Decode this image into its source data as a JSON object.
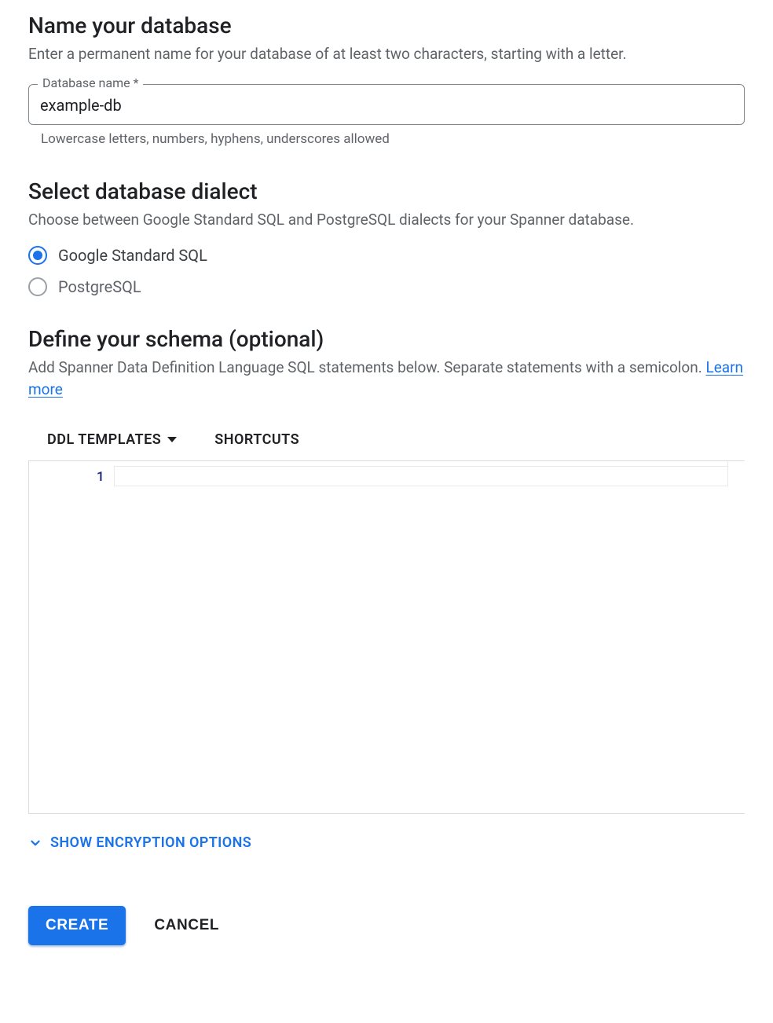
{
  "name_section": {
    "title": "Name your database",
    "description": "Enter a permanent name for your database of at least two characters, starting with a letter.",
    "field_label": "Database name *",
    "field_value": "example-db",
    "helper": "Lowercase letters, numbers, hyphens, underscores allowed"
  },
  "dialect_section": {
    "title": "Select database dialect",
    "description": "Choose between Google Standard SQL and PostgreSQL dialects for your Spanner database.",
    "options": [
      {
        "label": "Google Standard SQL",
        "selected": true
      },
      {
        "label": "PostgreSQL",
        "selected": false
      }
    ]
  },
  "schema_section": {
    "title": "Define your schema (optional)",
    "description_prefix": "Add Spanner Data Definition Language SQL statements below. Separate statements with a semicolon. ",
    "learn_more": "Learn more",
    "toolbar": {
      "ddl_templates": "DDL TEMPLATES",
      "shortcuts": "SHORTCUTS"
    },
    "editor": {
      "line_number": "1"
    }
  },
  "encryption_toggle": "SHOW ENCRYPTION OPTIONS",
  "footer": {
    "create": "CREATE",
    "cancel": "CANCEL"
  }
}
